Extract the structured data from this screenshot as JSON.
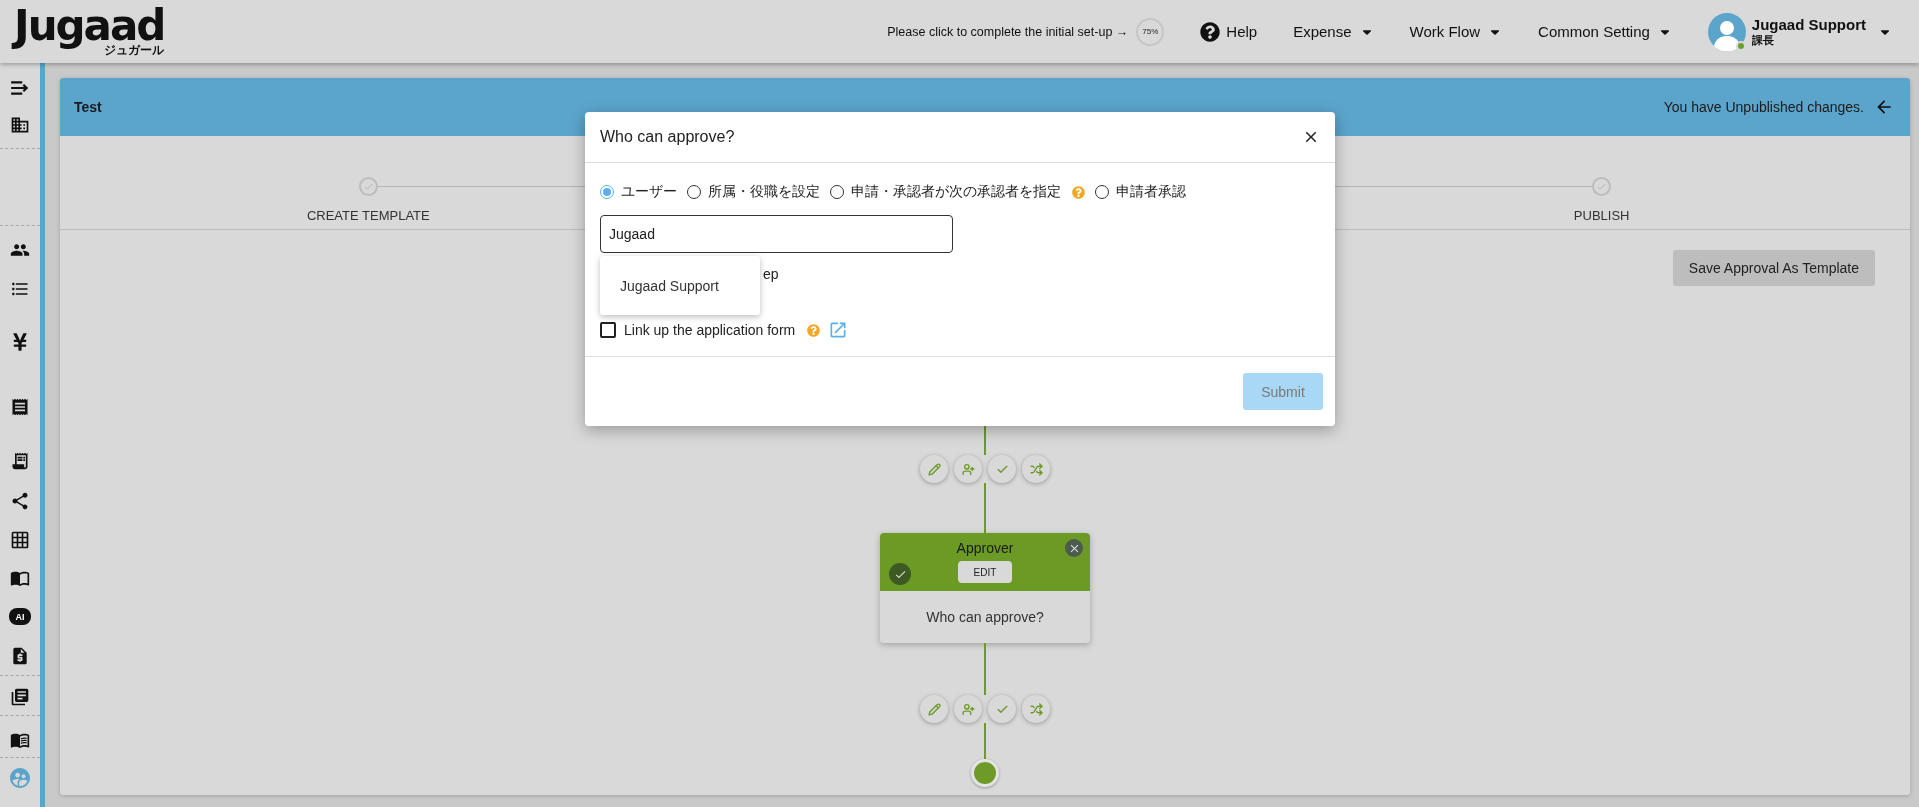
{
  "header": {
    "logo": "Jugaad",
    "logo_sub": "ジュガール",
    "setup_prompt": "Please click to complete the initial set-up →",
    "setup_progress": "75%",
    "help": "Help",
    "menus": [
      "Expense",
      "Work Flow",
      "Common Setting"
    ],
    "user": {
      "name": "Jugaad Support",
      "role": "課長",
      "online": true
    }
  },
  "sidebar": {
    "ai_label": "AI"
  },
  "panel": {
    "title": "Test",
    "notice": "You have Unpublished changes."
  },
  "stepper": {
    "steps": [
      {
        "label": "CREATE TEMPLATE"
      },
      {
        "label": "PUBLISH"
      }
    ]
  },
  "save_button": "Save Approval As Template",
  "flow": {
    "node": {
      "title": "Approver",
      "edit": "EDIT",
      "body": "Who can approve?"
    }
  },
  "modal": {
    "title": "Who can approve?",
    "options": [
      {
        "label": "ユーザー",
        "selected": true,
        "help": false
      },
      {
        "label": "所属・役職を設定",
        "selected": false,
        "help": false
      },
      {
        "label": "申請・承認者が次の承認者を指定",
        "selected": false,
        "help": true
      },
      {
        "label": "申請者承認",
        "selected": false,
        "help": false
      }
    ],
    "search": {
      "value": "Jugaad"
    },
    "suggestions": [
      "Jugaad Support"
    ],
    "covered_text": "ep",
    "link_form": {
      "label": "Link up the application form",
      "checked": false
    },
    "submit": {
      "label": "Submit",
      "disabled": true
    }
  }
}
